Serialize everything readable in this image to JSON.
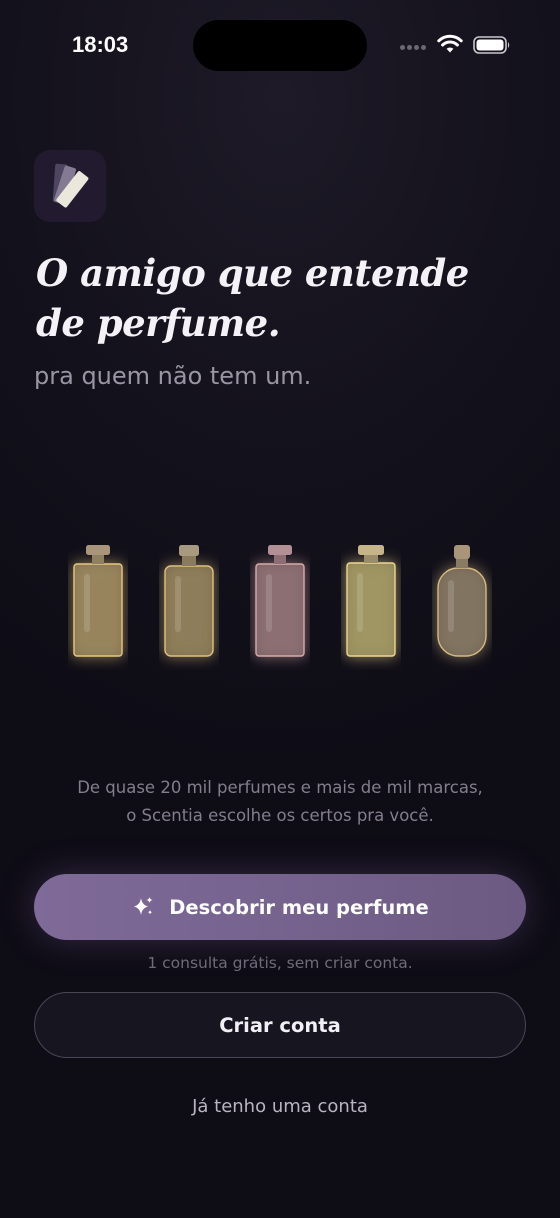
{
  "status_bar": {
    "time": "18:03"
  },
  "app": {
    "logo_icon": "fan-deck-icon"
  },
  "hero": {
    "headline_line1": "O amigo que entende",
    "headline_line2": "de perfume.",
    "subtitle": "pra quem não tem um."
  },
  "bottles": [
    {
      "icon": "perfume-bottle-icon",
      "glass": "#a28f63",
      "cap": "#a8957a"
    },
    {
      "icon": "perfume-bottle-icon",
      "glass": "#98875e",
      "cap": "#a89a7e"
    },
    {
      "icon": "perfume-bottle-icon",
      "glass": "#937678",
      "cap": "#b39096"
    },
    {
      "icon": "perfume-bottle-icon",
      "glass": "#a79c66",
      "cap": "#c5b588"
    },
    {
      "icon": "perfume-bottle-icon",
      "glass": "#8a7d66",
      "cap": "#a8957a"
    }
  ],
  "description": {
    "line1": "De quase 20 mil perfumes e mais de mil marcas,",
    "line2": "o Scentia escolhe os certos pra você."
  },
  "actions": {
    "discover_label": "Descobrir meu perfume",
    "discover_icon": "sparkle-icon",
    "free_note": "1 consulta grátis, sem criar conta.",
    "create_account_label": "Criar conta",
    "login_label": "Já tenho uma conta"
  },
  "colors": {
    "background": "#0f0d17",
    "accent": "#7a6693",
    "bottle_glow": "#d9b15c"
  }
}
